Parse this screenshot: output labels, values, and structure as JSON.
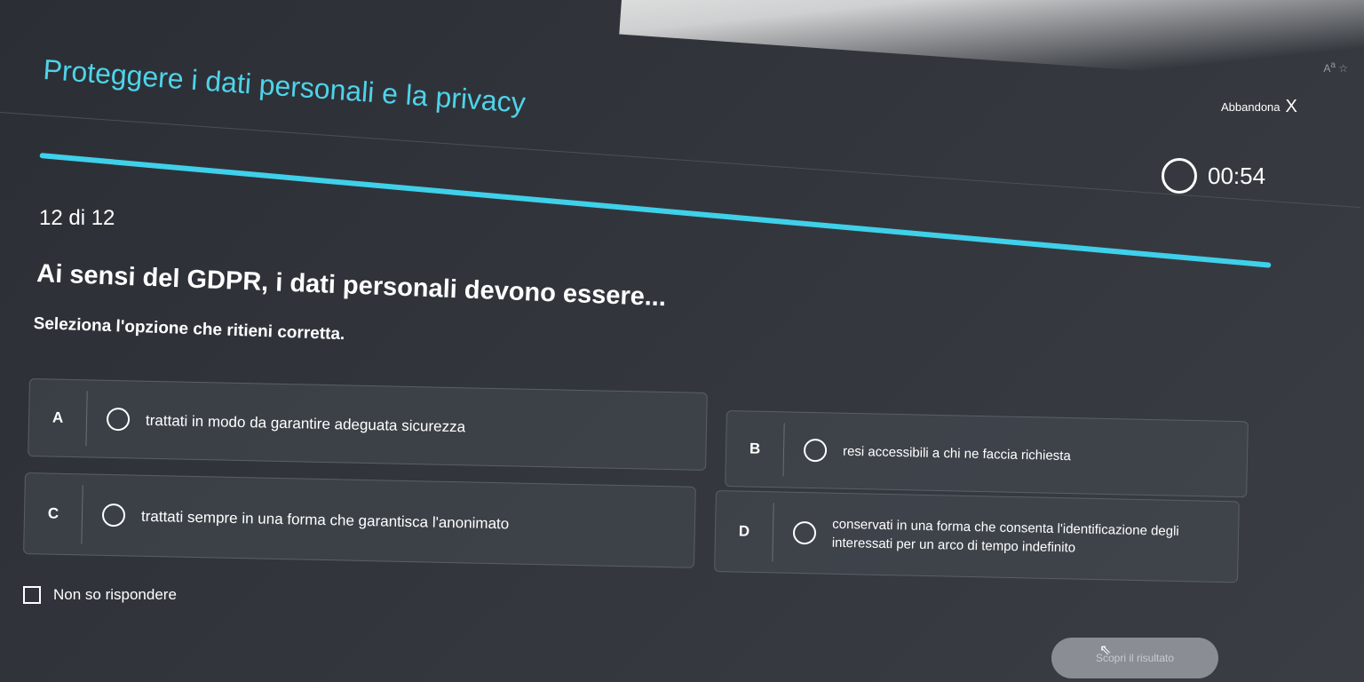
{
  "header": {
    "title": "Proteggere i dati personali e la privacy",
    "abandon_label": "Abbandona",
    "close_glyph": "X"
  },
  "progress": {
    "counter": "12 di 12",
    "fraction": 1.0,
    "timer": "00:54"
  },
  "question": {
    "text": "Ai sensi del GDPR, i dati personali devono essere...",
    "instruction": "Seleziona l'opzione che ritieni corretta."
  },
  "options": [
    {
      "letter": "A",
      "text": "trattati in modo da garantire adeguata sicurezza"
    },
    {
      "letter": "B",
      "text": "resi accessibili a chi ne faccia richiesta"
    },
    {
      "letter": "C",
      "text": "trattati sempre in una forma che garantisca l'anonimato"
    },
    {
      "letter": "D",
      "text": "conservati in una forma che consenta l'identificazione degli interessati per un arco di tempo indefinito"
    }
  ],
  "dont_know_label": "Non so rispondere",
  "submit_label": "Scopri il risultato",
  "colors": {
    "accent": "#3fd0ea",
    "title": "#4fd3ea",
    "background": "#2f3339"
  }
}
